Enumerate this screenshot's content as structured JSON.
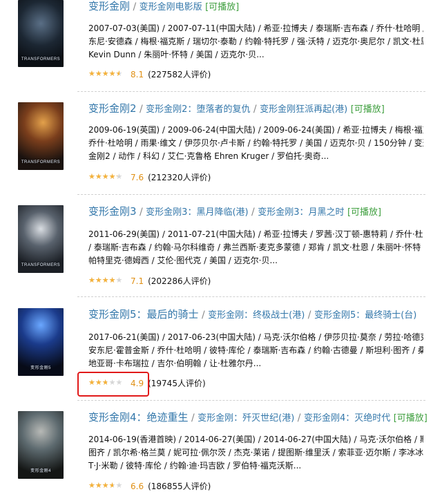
{
  "items": [
    {
      "title_main": "变形金刚",
      "title_alt": "变形金刚电影版",
      "title_alt2": "",
      "play_label": "[可播放]",
      "lines": [
        "2007-07-03(美国) / 2007-07-11(中国大陆) / 希亚·拉博夫 / 泰瑞斯·吉布森 / 乔什·杜哈明 / 安",
        "东尼·安德森 / 梅根·福克斯 / 瑞切尔·泰勒 / 约翰·特托罗 / 强·沃特 / 迈克尔·奥尼尔 / 凯文·杜恩 /",
        "Kevin Dunn / 朱丽叶·怀特 / 美国 / 迈克尔·贝..."
      ],
      "rating_fraction": 0.81,
      "score": "8.1",
      "count": "(227582人评价)",
      "poster_text": "TRANSFORMERS"
    },
    {
      "title_main": "变形金刚2",
      "title_alt": "变形金刚2：堕落者的复仇",
      "title_alt2": "变形金刚狂派再起(港)",
      "play_label": "[可播放]",
      "lines": [
        "2009-06-19(英国) / 2009-06-24(中国大陆) / 2009-06-24(美国) / 希亚·拉博夫 / 梅根·福克斯 /",
        "乔什·杜哈明 / 雨果·维文 / 伊莎贝尔·卢卡斯 / 约翰·特托罗 / 美国 / 迈克尔·贝 / 150分钟 / 变形",
        "金刚2 / 动作 / 科幻 / 艾仁·克鲁格 Ehren Kruger / 罗伯托·奥奇..."
      ],
      "rating_fraction": 0.76,
      "score": "7.6",
      "count": "(212320人评价)",
      "poster_text": "TRANSFORMERS"
    },
    {
      "title_main": "变形金刚3",
      "title_alt": "变形金刚3：黑月降临(港)",
      "title_alt2": "变形金刚3：月黑之时",
      "play_label": "[可播放]",
      "lines": [
        "2011-06-29(美国) / 2011-07-21(中国大陆) / 希亚·拉博夫 / 罗茜·汉丁顿-惠特莉 / 乔什·杜哈明",
        "/ 泰瑞斯·吉布森 / 约翰·马尔科维奇 / 弗兰西斯·麦克多蒙德 / 郑肯 / 凯文·杜恩 / 朱丽叶·怀特 /",
        "帕特里克·德姆西 / 艾伦·图代克 / 美国 / 迈克尔·贝..."
      ],
      "rating_fraction": 0.71,
      "score": "7.1",
      "count": "(202286人评价)",
      "poster_text": "TRANSFORMERS"
    },
    {
      "title_main": "变形金刚5：最后的骑士",
      "title_alt": "变形金刚：终极战士(港)",
      "title_alt2": "变形金刚5：最终骑士(台)",
      "play_label": "",
      "lines": [
        "2017-06-21(美国) / 2017-06-23(中国大陆) / 马克·沃尔伯格 / 伊莎贝拉·莫奈 / 劳拉·哈德克 /",
        "安东尼·霍普金斯 / 乔什·杜哈明 / 彼特·库伦 / 泰瑞斯·吉布森 / 约翰·古德曼 / 斯坦利·图齐 / 桑",
        "地亚哥·卡布瑞拉 / 吉尔·伯明翰 / 让·杜雅尔丹..."
      ],
      "rating_fraction": 0.49,
      "score": "4.9",
      "count": "(19745人评价)",
      "poster_text": "变形金刚5"
    },
    {
      "title_main": "变形金刚4：绝迹重生",
      "title_alt": "变形金刚：歼灭世纪(港)",
      "title_alt2": "变形金刚4：灭绝时代",
      "play_label": "[可播放]",
      "lines": [
        "2014-06-19(香港首映) / 2014-06-27(美国) / 2014-06-27(中国大陆) / 马克·沃尔伯格 / 斯坦利·",
        "图齐 / 凯尔希·格兰莫 / 妮可拉·佩尔茨 / 杰克·莱诺 / 提图斯·维里沃 / 索菲亚·迈尔斯 / 李冰冰 /",
        "T·J·米勒 / 彼特·库伦 / 约翰·迪·玛吉欧 / 罗伯特·福克沃斯..."
      ],
      "rating_fraction": 0.66,
      "score": "6.6",
      "count": "(186855人评价)",
      "poster_text": "变形金刚4"
    }
  ],
  "colors": {
    "link": "#3377aa",
    "playable": "#3f9f3f",
    "star": "#f5b23b",
    "score": "#e09015",
    "highlight": "#e11919"
  }
}
